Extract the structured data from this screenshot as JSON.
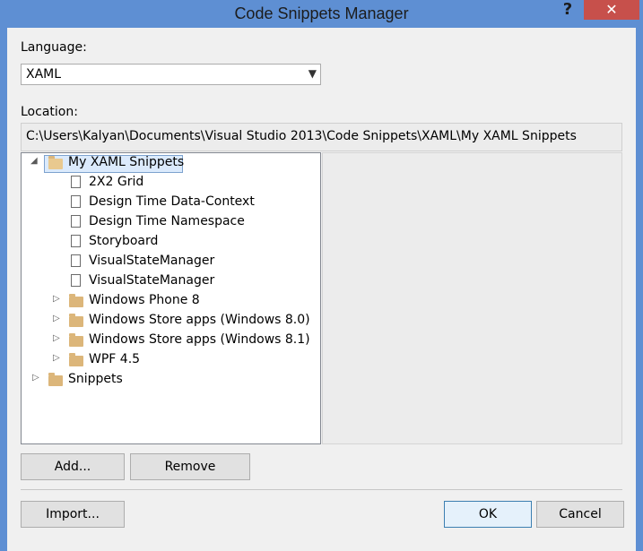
{
  "window": {
    "title": "Code Snippets Manager",
    "help_glyph": "?",
    "close_glyph": "✕"
  },
  "language": {
    "label": "Language:",
    "selected": "XAML"
  },
  "location": {
    "label": "Location:",
    "path": "C:\\Users\\Kalyan\\Documents\\Visual Studio 2013\\Code Snippets\\XAML\\My XAML Snippets"
  },
  "tree": {
    "root_expander": "◢",
    "collapsed_expander": "▷",
    "root": "My XAML Snippets",
    "snippets": [
      "2X2 Grid",
      "Design Time Data-Context",
      "Design Time Namespace",
      "Storyboard",
      "VisualStateManager",
      "VisualStateManager"
    ],
    "subfolders": [
      "Windows Phone 8",
      "Windows Store apps (Windows 8.0)",
      "Windows Store apps (Windows 8.1)",
      "WPF 4.5"
    ],
    "other_root": "Snippets"
  },
  "buttons": {
    "add": "Add...",
    "remove": "Remove",
    "import": "Import...",
    "ok": "OK",
    "cancel": "Cancel"
  },
  "colors": {
    "title_bar": "#5e8fd3",
    "close_button": "#c7504b",
    "selection": "#dbeafc",
    "folder": "#dcb67a"
  }
}
